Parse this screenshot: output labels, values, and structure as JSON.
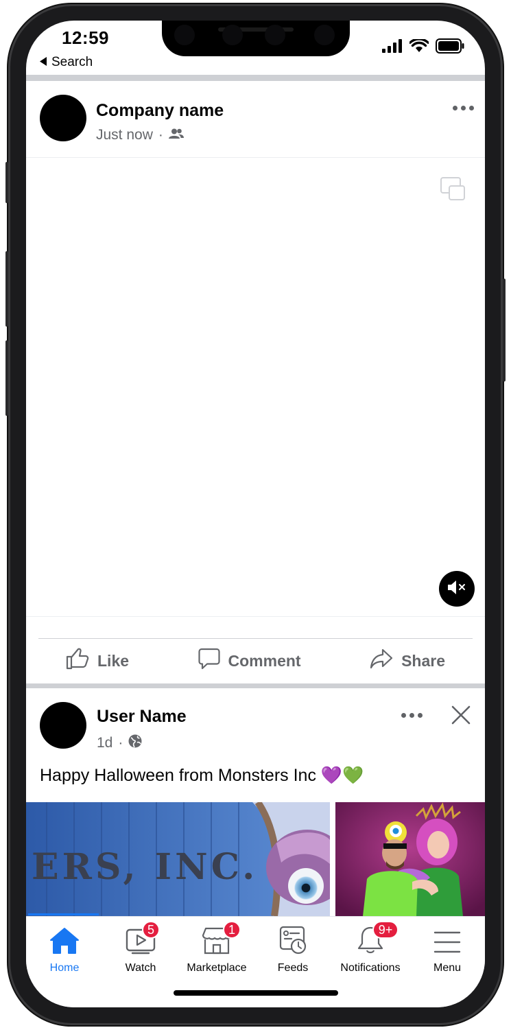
{
  "status_bar": {
    "time": "12:59",
    "back_label": "Search"
  },
  "posts": [
    {
      "author": "Company name",
      "timestamp": "Just now",
      "audience_icon": "friends-icon",
      "media": "video",
      "mute_icon": "speaker-muted-icon"
    },
    {
      "author": "User Name",
      "timestamp": "1d",
      "audience_icon": "globe-icon",
      "text": "Happy Halloween from Monsters Inc",
      "emoji": "💜💚",
      "photo_left_text": "ERS, INC."
    }
  ],
  "actions": {
    "like": "Like",
    "comment": "Comment",
    "share": "Share"
  },
  "tabs": [
    {
      "label": "Home",
      "icon": "home-icon",
      "active": true
    },
    {
      "label": "Watch",
      "icon": "video-icon",
      "badge": "5"
    },
    {
      "label": "Marketplace",
      "icon": "store-icon",
      "badge": "1"
    },
    {
      "label": "Feeds",
      "icon": "feeds-icon"
    },
    {
      "label": "Notifications",
      "icon": "bell-icon",
      "badge": "9+"
    },
    {
      "label": "Menu",
      "icon": "menu-icon"
    }
  ],
  "colors": {
    "accent": "#1877f2",
    "badge": "#e41e3f",
    "secondary_text": "#65676b"
  }
}
